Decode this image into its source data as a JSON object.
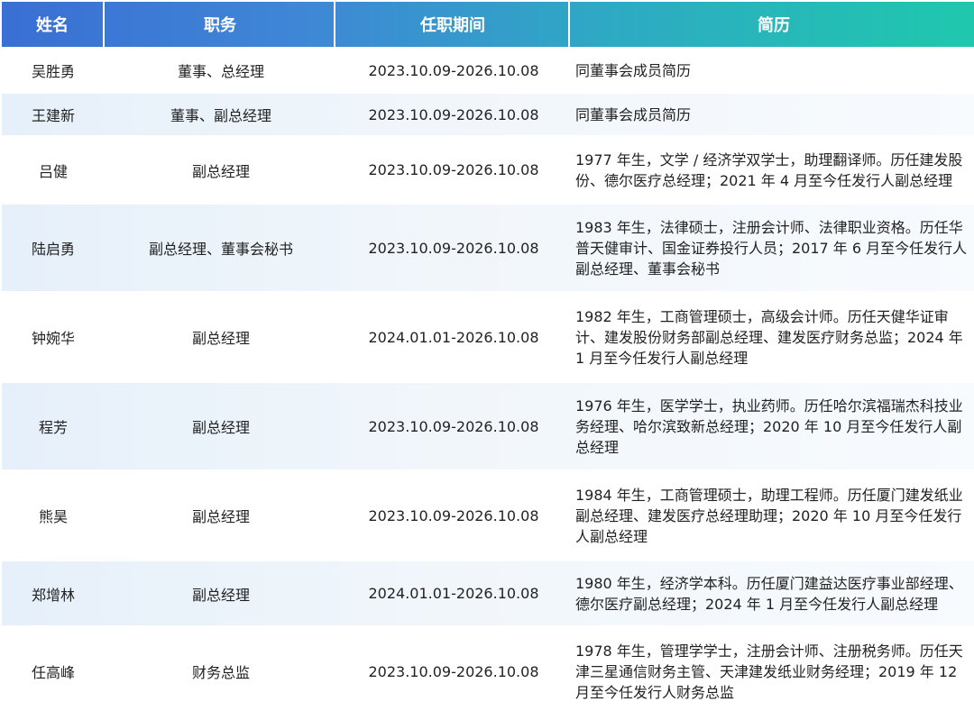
{
  "header": {
    "name": "姓名",
    "position": "职务",
    "term": "任职期间",
    "bio": "简历"
  },
  "rows": [
    {
      "name": "吴胜勇",
      "position": "董事、总经理",
      "term": "2023.10.09-2026.10.08",
      "bio": "同董事会成员简历"
    },
    {
      "name": "王建新",
      "position": "董事、副总经理",
      "term": "2023.10.09-2026.10.08",
      "bio": "同董事会成员简历"
    },
    {
      "name": "吕健",
      "position": "副总经理",
      "term": "2023.10.09-2026.10.08",
      "bio": "1977 年生，文学 / 经济学双学士，助理翻译师。历任建发股份、德尔医疗总经理；2021 年 4 月至今任发行人副总经理"
    },
    {
      "name": "陆启勇",
      "position": "副总经理、董事会秘书",
      "term": "2023.10.09-2026.10.08",
      "bio": "1983 年生，法律硕士，注册会计师、法律职业资格。历任华普天健审计、国金证券投行人员；2017 年 6 月至今任发行人副总经理、董事会秘书"
    },
    {
      "name": "钟婉华",
      "position": "副总经理",
      "term": "2024.01.01-2026.10.08",
      "bio": "1982 年生，工商管理硕士，高级会计师。历任天健华证审计、建发股份财务部副总经理、建发医疗财务总监；2024 年 1 月至今任发行人副总经理"
    },
    {
      "name": "程芳",
      "position": "副总经理",
      "term": "2023.10.09-2026.10.08",
      "bio": "1976 年生，医学学士，执业药师。历任哈尔滨福瑞杰科技业务经理、哈尔滨致新总经理；2020 年 10 月至今任发行人副总经理"
    },
    {
      "name": "熊昊",
      "position": "副总经理",
      "term": "2023.10.09-2026.10.08",
      "bio": "1984 年生，工商管理硕士，助理工程师。历任厦门建发纸业副总经理、建发医疗总经理助理；2020 年 10 月至今任发行人副总经理"
    },
    {
      "name": "郑增林",
      "position": "副总经理",
      "term": "2024.01.01-2026.10.08",
      "bio": "1980 年生，经济学本科。历任厦门建益达医疗事业部经理、德尔医疗副总经理；2024 年 1 月至今任发行人副总经理"
    },
    {
      "name": "任高峰",
      "position": "财务总监",
      "term": "2023.10.09-2026.10.08",
      "bio": "1978 年生，管理学学士，注册会计师、注册税务师。历任天津三星通信财务主管、天津建发纸业财务经理；2019 年 12 月至今任发行人财务总监"
    }
  ]
}
